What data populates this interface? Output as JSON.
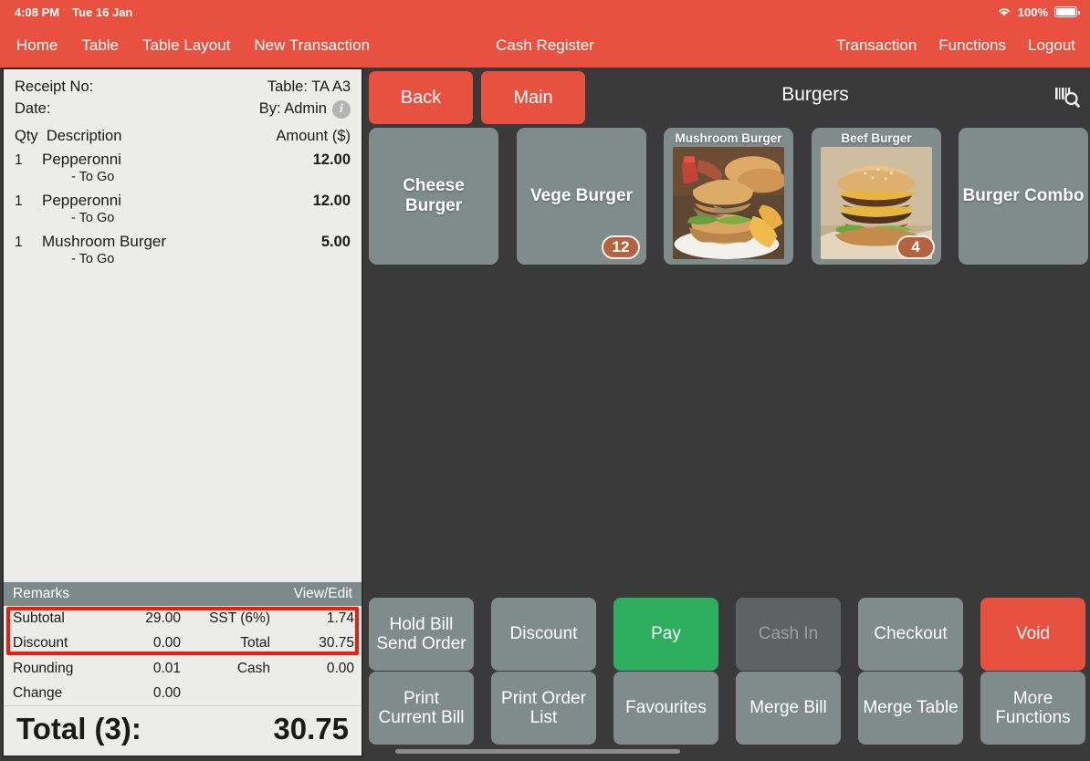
{
  "statusbar": {
    "time": "4:08 PM",
    "date": "Tue 16 Jan",
    "battery_percent": "100%",
    "wifi_icon": "wifi-icon",
    "battery_icon": "battery-icon"
  },
  "navbar": {
    "title": "Cash Register",
    "left_items": [
      {
        "label": "Home"
      },
      {
        "label": "Table"
      },
      {
        "label": "Table Layout"
      },
      {
        "label": "New Transaction"
      }
    ],
    "right_items": [
      {
        "label": "Transaction"
      },
      {
        "label": "Functions"
      },
      {
        "label": "Logout"
      }
    ]
  },
  "receipt": {
    "receipt_no_label": "Receipt No:",
    "receipt_no_value": "",
    "table_label": "Table: TA A3",
    "date_label": "Date:",
    "date_value": "",
    "by_label": "By: Admin",
    "info_icon": "info-icon",
    "col_qty": "Qty",
    "col_description": "Description",
    "col_amount": "Amount ($)",
    "items": [
      {
        "qty": "1",
        "description": "Pepperonni",
        "modifier": "- To Go",
        "amount": "12.00"
      },
      {
        "qty": "1",
        "description": "Pepperonni",
        "modifier": "- To Go",
        "amount": "12.00"
      },
      {
        "qty": "1",
        "description": "Mushroom Burger",
        "modifier": "- To Go",
        "amount": "5.00"
      }
    ],
    "remarks_label": "Remarks",
    "remarks_action": "View/Edit",
    "totals": [
      {
        "label_left": "Subtotal",
        "value_left": "29.00",
        "label_right": "SST (6%)",
        "value_right": "1.74"
      },
      {
        "label_left": "Discount",
        "value_left": "0.00",
        "label_right": "Total",
        "value_right": "30.75"
      },
      {
        "label_left": "Rounding",
        "value_left": "0.01",
        "label_right": "Cash",
        "value_right": "0.00"
      },
      {
        "label_left": "Change",
        "value_left": "0.00",
        "label_right": "",
        "value_right": ""
      }
    ],
    "highlight_color": "#f01c0b",
    "grand_total_label": "Total (3):",
    "grand_total_value": "30.75"
  },
  "content": {
    "back_label": "Back",
    "main_label": "Main",
    "category_title": "Burgers",
    "scan_icon": "barcode-scan-icon",
    "tiles": [
      {
        "name": "Cheese Burger",
        "has_image": false,
        "badge": ""
      },
      {
        "name": "Vege Burger",
        "has_image": false,
        "badge": "12"
      },
      {
        "name": "Mushroom Burger",
        "has_image": true,
        "badge": ""
      },
      {
        "name": "Beef Burger",
        "has_image": true,
        "badge": "4"
      },
      {
        "name": "Burger Combo",
        "has_image": false,
        "badge": ""
      }
    ]
  },
  "actions": {
    "row1": [
      {
        "label": "Hold Bill\nSend Order",
        "style": "default",
        "disabled": false
      },
      {
        "label": "Discount",
        "style": "default",
        "disabled": false
      },
      {
        "label": "Pay",
        "style": "pay",
        "disabled": false
      },
      {
        "label": "Cash In",
        "style": "disabled",
        "disabled": true
      },
      {
        "label": "Checkout",
        "style": "default",
        "disabled": false
      },
      {
        "label": "Void",
        "style": "void",
        "disabled": false
      }
    ],
    "row2": [
      {
        "label": "Print\nCurrent Bill",
        "style": "default",
        "disabled": false
      },
      {
        "label": "Print Order\nList",
        "style": "default",
        "disabled": false
      },
      {
        "label": "Favourites",
        "style": "default",
        "disabled": false
      },
      {
        "label": "Merge Bill",
        "style": "default",
        "disabled": false
      },
      {
        "label": "Merge Table",
        "style": "default",
        "disabled": false
      },
      {
        "label": "More\nFunctions",
        "style": "default",
        "disabled": false
      }
    ]
  },
  "colors": {
    "accent_red": "#e8503f",
    "tile_gray": "#808c8c",
    "pay_green": "#2dae5e",
    "badge_brown": "#b5633e",
    "background": "#3a3a3a",
    "remarks_bar": "#7d8a8a"
  }
}
